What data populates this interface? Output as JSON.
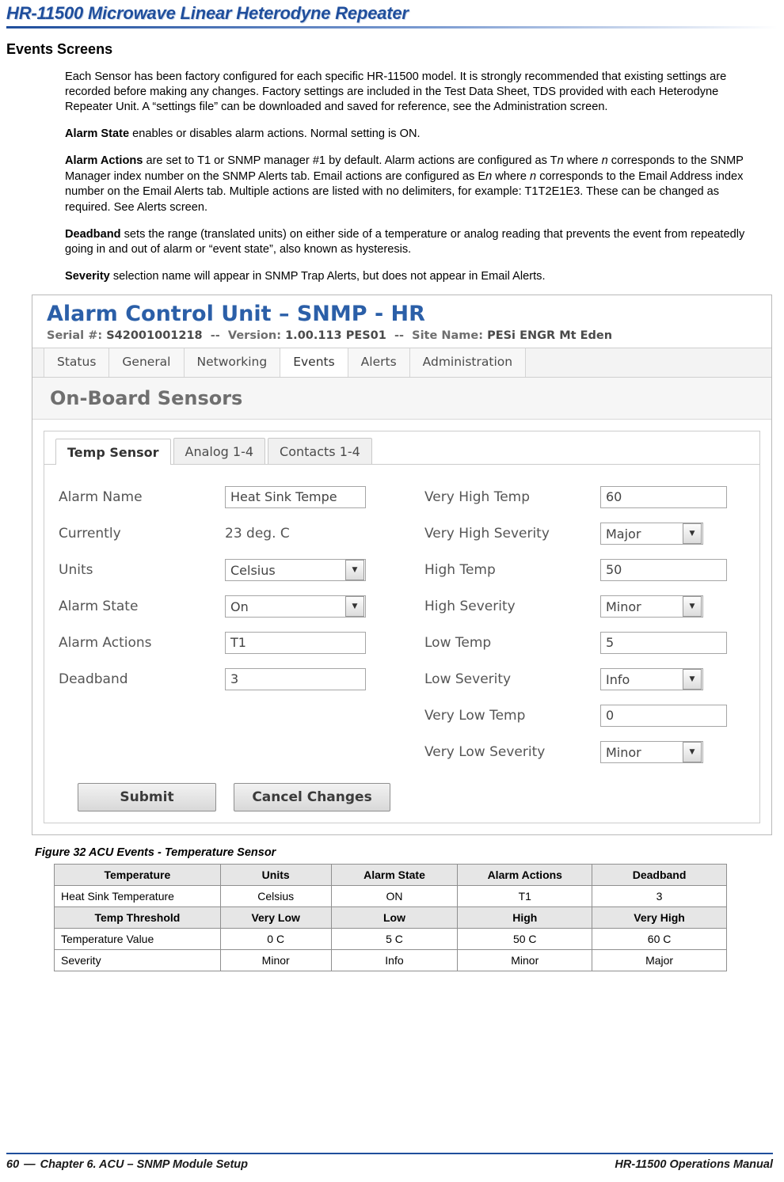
{
  "header": {
    "title": "HR-11500 Microwave Linear Heterodyne Repeater"
  },
  "section": {
    "title": "Events Screens"
  },
  "paragraphs": [
    "Each Sensor has been factory configured for each specific HR-11500 model. It is strongly recommended that existing settings are recorded before making any changes. Factory settings are included in the Test Data Sheet, TDS provided with each Heterodyne Repeater Unit. A “settings file” can be downloaded and saved for reference, see the Administration screen."
  ],
  "terms": {
    "alarm_state": {
      "term": "Alarm State",
      "text": " enables or disables alarm actions. Normal setting is ON."
    },
    "alarm_actions": {
      "term": "Alarm Actions",
      "part1": " are set to T1 or SNMP manager #1 by default. Alarm actions are configured as T",
      "i1": "n",
      "part2": " where ",
      "i2": "n",
      "part3": " corresponds to the SNMP Manager index number on the SNMP Alerts tab. Email actions are configured as E",
      "i3": "n",
      "part4": " where ",
      "i4": "n",
      "part5": " corresponds to the Email Address index number on the Email Alerts tab. Multiple actions are listed with no delimiters, for example: T1T2E1E3. These can be changed as required. See Alerts screen."
    },
    "deadband": {
      "term": "Deadband",
      "text": " sets the range (translated units) on either side of a temperature or analog reading that prevents the event from repeatedly going in and out of alarm or “event state”, also known as hysteresis."
    },
    "severity": {
      "term": "Severity",
      "text": " selection name will appear in SNMP Trap Alerts, but does not appear in Email Alerts."
    }
  },
  "screenshot": {
    "title": "Alarm Control Unit – SNMP - HR",
    "subtitle": {
      "serial_label": "Serial #:",
      "serial_value": "S42001001218",
      "sep1": "--",
      "version_label": "Version:",
      "version_value": "1.00.113 PES01",
      "sep2": "--",
      "site_label": "Site Name:",
      "site_value": "PESi ENGR Mt Eden"
    },
    "tabs": [
      {
        "label": "Status",
        "active": false
      },
      {
        "label": "General",
        "active": false
      },
      {
        "label": "Networking",
        "active": false
      },
      {
        "label": "Events",
        "active": true
      },
      {
        "label": "Alerts",
        "active": false
      },
      {
        "label": "Administration",
        "active": false
      }
    ],
    "panel_heading": "On-Board Sensors",
    "subtabs": [
      {
        "label": "Temp Sensor",
        "active": true
      },
      {
        "label": "Analog 1-4",
        "active": false
      },
      {
        "label": "Contacts 1-4",
        "active": false
      }
    ],
    "left_fields": [
      {
        "label": "Alarm Name",
        "value": "Heat Sink Tempe",
        "type": "input"
      },
      {
        "label": "Currently",
        "value": "23 deg. C",
        "type": "text"
      },
      {
        "label": "Units",
        "value": "Celsius",
        "type": "select"
      },
      {
        "label": "Alarm State",
        "value": "On",
        "type": "select"
      },
      {
        "label": "Alarm Actions",
        "value": "T1",
        "type": "input"
      },
      {
        "label": "Deadband",
        "value": "3",
        "type": "input"
      }
    ],
    "right_fields": [
      {
        "label": "Very High Temp",
        "value": "60",
        "type": "input"
      },
      {
        "label": "Very High Severity",
        "value": "Major",
        "type": "select"
      },
      {
        "label": "High Temp",
        "value": "50",
        "type": "input"
      },
      {
        "label": "High Severity",
        "value": "Minor",
        "type": "select"
      },
      {
        "label": "Low Temp",
        "value": "5",
        "type": "input"
      },
      {
        "label": "Low Severity",
        "value": "Info",
        "type": "select"
      },
      {
        "label": "Very Low Temp",
        "value": "0",
        "type": "input"
      },
      {
        "label": "Very Low Severity",
        "value": "Minor",
        "type": "select"
      }
    ],
    "buttons": {
      "submit": "Submit",
      "cancel": "Cancel Changes"
    }
  },
  "figure_caption": "Figure 32  ACU Events - Temperature Sensor",
  "table": {
    "header1": [
      "Temperature",
      "Units",
      "Alarm State",
      "Alarm Actions",
      "Deadband"
    ],
    "row1": [
      "Heat Sink Temperature",
      "Celsius",
      "ON",
      "T1",
      "3"
    ],
    "header2": [
      "Temp Threshold",
      "Very Low",
      "Low",
      "High",
      "Very High"
    ],
    "row2": [
      "Temperature Value",
      "0 C",
      "5 C",
      "50 C",
      "60 C"
    ],
    "row3": [
      "Severity",
      "Minor",
      "Info",
      "Minor",
      "Major"
    ]
  },
  "footer": {
    "page": "60",
    "dash": "—",
    "chapter": "Chapter 6. ACU – SNMP Module Setup",
    "manual": "HR-11500 Operations Manual"
  }
}
